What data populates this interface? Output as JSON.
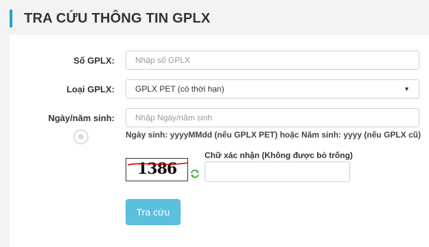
{
  "header": {
    "title": "TRA CỨU THÔNG TIN GPLX"
  },
  "form": {
    "license_number": {
      "label": "Số GPLX:",
      "placeholder": "Nhập số GPLX"
    },
    "license_type": {
      "label": "Loại GPLX:",
      "selected": "GPLX PET (có thời hạn)"
    },
    "birth_date": {
      "label": "Ngày/năm sinh:",
      "placeholder": "Nhập Ngày/năm sinh",
      "hint": "Ngày sinh: yyyyMMdd (nếu GPLX PET) hoặc Năm sinh: yyyy (nếu GPLX cũ)"
    },
    "captcha": {
      "code": "1386",
      "label": "Chữ xác nhận (Không được bỏ trống)"
    },
    "submit_label": "Tra cứu"
  },
  "icons": {
    "select_arrow": "caret-down-icon",
    "refresh": "refresh-icon"
  },
  "colors": {
    "accent": "#2b9fd8",
    "button": "#5bc0de",
    "captcha_line": "#cc0000",
    "refresh": "#4caf50"
  }
}
